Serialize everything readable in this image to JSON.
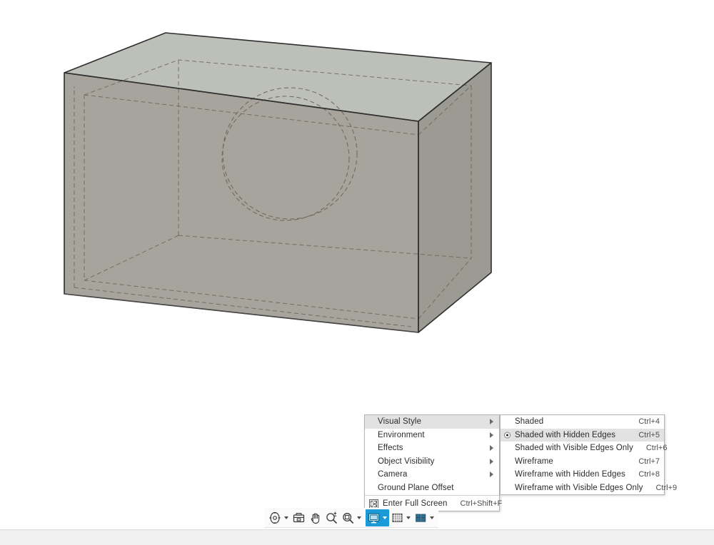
{
  "viewport": {
    "name": "3d-viewport",
    "background": "#ffffff",
    "model": {
      "description": "Shaded rectangular box with hidden edges and a cylindrical through-hole",
      "face_top_color": "#b7bcb4",
      "face_front_color": "#a6a29c",
      "face_right_color": "#9a9a92",
      "edge_color": "#2e2e2e",
      "hidden_edge_color": "#6d6257"
    }
  },
  "context_menu": {
    "items": [
      {
        "label": "Visual Style",
        "has_submenu": true,
        "highlighted": true
      },
      {
        "label": "Environment",
        "has_submenu": true,
        "highlighted": false
      },
      {
        "label": "Effects",
        "has_submenu": true,
        "highlighted": false
      },
      {
        "label": "Object Visibility",
        "has_submenu": true,
        "highlighted": false
      },
      {
        "label": "Camera",
        "has_submenu": true,
        "highlighted": false
      },
      {
        "label": "Ground Plane Offset",
        "has_submenu": false,
        "highlighted": false
      }
    ],
    "fullscreen": {
      "label": "Enter Full Screen",
      "accel": "Ctrl+Shift+F",
      "icon": "fullscreen-icon"
    }
  },
  "submenu": {
    "title": "Visual Style",
    "items": [
      {
        "label": "Shaded",
        "accel": "Ctrl+4",
        "selected": false,
        "highlighted": false
      },
      {
        "label": "Shaded with Hidden Edges",
        "accel": "Ctrl+5",
        "selected": true,
        "highlighted": true
      },
      {
        "label": "Shaded with Visible Edges Only",
        "accel": "Ctrl+6",
        "selected": false,
        "highlighted": false
      },
      {
        "label": "Wireframe",
        "accel": "Ctrl+7",
        "selected": false,
        "highlighted": false
      },
      {
        "label": "Wireframe with Hidden Edges",
        "accel": "Ctrl+8",
        "selected": false,
        "highlighted": false
      },
      {
        "label": "Wireframe with Visible Edges Only",
        "accel": "Ctrl+9",
        "selected": false,
        "highlighted": false
      }
    ]
  },
  "toolbar": {
    "active_color": "#1a9ad7",
    "buttons": [
      {
        "name": "orbit-icon",
        "tooltip": "Orbit",
        "has_caret": true,
        "active": false
      },
      {
        "name": "look-at-icon",
        "tooltip": "Look At",
        "has_caret": false,
        "active": false
      },
      {
        "name": "pan-hand-icon",
        "tooltip": "Pan",
        "has_caret": false,
        "active": false
      },
      {
        "name": "zoom-icon",
        "tooltip": "Zoom",
        "has_caret": false,
        "active": false
      },
      {
        "name": "fit-view-icon",
        "tooltip": "Fit",
        "has_caret": true,
        "active": false
      },
      {
        "name": "display-settings-icon",
        "tooltip": "Display Settings",
        "has_caret": true,
        "active": true
      },
      {
        "name": "grid-snaps-icon",
        "tooltip": "Grid and Snaps",
        "has_caret": true,
        "active": false
      },
      {
        "name": "viewports-icon",
        "tooltip": "Viewports",
        "has_caret": true,
        "active": false
      }
    ]
  },
  "statusbar": {
    "text": ""
  }
}
